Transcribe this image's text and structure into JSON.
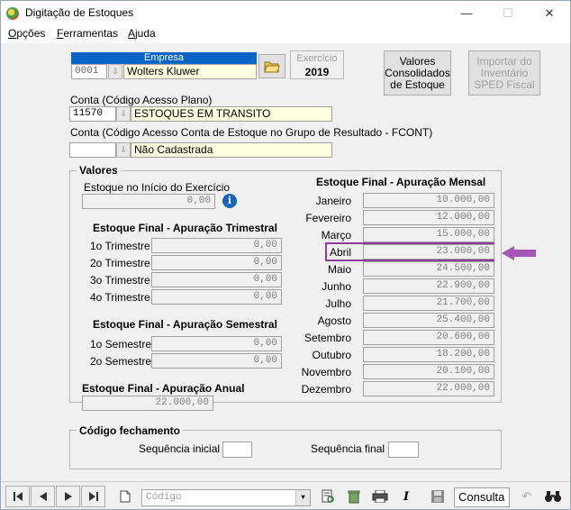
{
  "window": {
    "title": "Digitação de Estoques",
    "controls": {
      "minimize": "—",
      "maximize": "☐",
      "close": "✕"
    }
  },
  "menu": {
    "items": [
      {
        "label": "Opções",
        "accel": "O"
      },
      {
        "label": "Ferramentas",
        "accel": "F"
      },
      {
        "label": "Ajuda",
        "accel": "A"
      }
    ]
  },
  "empresa": {
    "header": "Empresa",
    "code": "0001",
    "name": "Wolters Kluwer"
  },
  "exercicio": {
    "label": "Exercício",
    "value": "2019"
  },
  "buttons": {
    "valores": "Valores\nConsolidados\nde Estoque",
    "importar": "Importar do\nInventário\nSPED Fiscal"
  },
  "conta": {
    "label": "Conta (Código Acesso Plano)",
    "code": "11570",
    "name": "ESTOQUES EM TRANSITO"
  },
  "conta_fcont": {
    "label": "Conta (Código Acesso Conta de Estoque no Grupo de Resultado - FCONT)",
    "code": "",
    "name": "Não Cadastrada"
  },
  "valores": {
    "title": "Valores",
    "inicio_label": "Estoque no Início do Exercício",
    "inicio_value": "0,00",
    "trimestral": {
      "title": "Estoque Final - Apuração Trimestral",
      "rows": [
        {
          "label": "1o Trimestre",
          "value": "0,00"
        },
        {
          "label": "2o Trimestre",
          "value": "0,00"
        },
        {
          "label": "3o Trimestre",
          "value": "0,00"
        },
        {
          "label": "4o Trimestre",
          "value": "0,00"
        }
      ]
    },
    "semestral": {
      "title": "Estoque Final - Apuração Semestral",
      "rows": [
        {
          "label": "1o Semestre",
          "value": "0,00"
        },
        {
          "label": "2o Semestre",
          "value": "0,00"
        }
      ]
    },
    "anual": {
      "title": "Estoque Final - Apuração Anual",
      "value": "22.000,00"
    },
    "mensal": {
      "title": "Estoque Final - Apuração Mensal",
      "rows": [
        {
          "label": "Janeiro",
          "value": "10.000,00"
        },
        {
          "label": "Fevereiro",
          "value": "12.000,00"
        },
        {
          "label": "Março",
          "value": "15.000,00"
        },
        {
          "label": "Abril",
          "value": "23.000,00"
        },
        {
          "label": "Maio",
          "value": "24.500,00"
        },
        {
          "label": "Junho",
          "value": "22.900,00"
        },
        {
          "label": "Julho",
          "value": "21.700,00"
        },
        {
          "label": "Agosto",
          "value": "25.400,00"
        },
        {
          "label": "Setembro",
          "value": "20.600,00"
        },
        {
          "label": "Outubro",
          "value": "18.200,00"
        },
        {
          "label": "Novembro",
          "value": "20.100,00"
        },
        {
          "label": "Dezembro",
          "value": "22.000,00"
        }
      ]
    }
  },
  "fechamento": {
    "title": "Código fechamento",
    "inicial_label": "Sequência inicial",
    "final_label": "Sequência final"
  },
  "statusbar": {
    "search_placeholder": "Código",
    "mode": "Consulta"
  },
  "colors": {
    "highlight": "#8e3b9b",
    "empresa_header": "#0a64c8",
    "yellow_field": "#ffffe1"
  }
}
